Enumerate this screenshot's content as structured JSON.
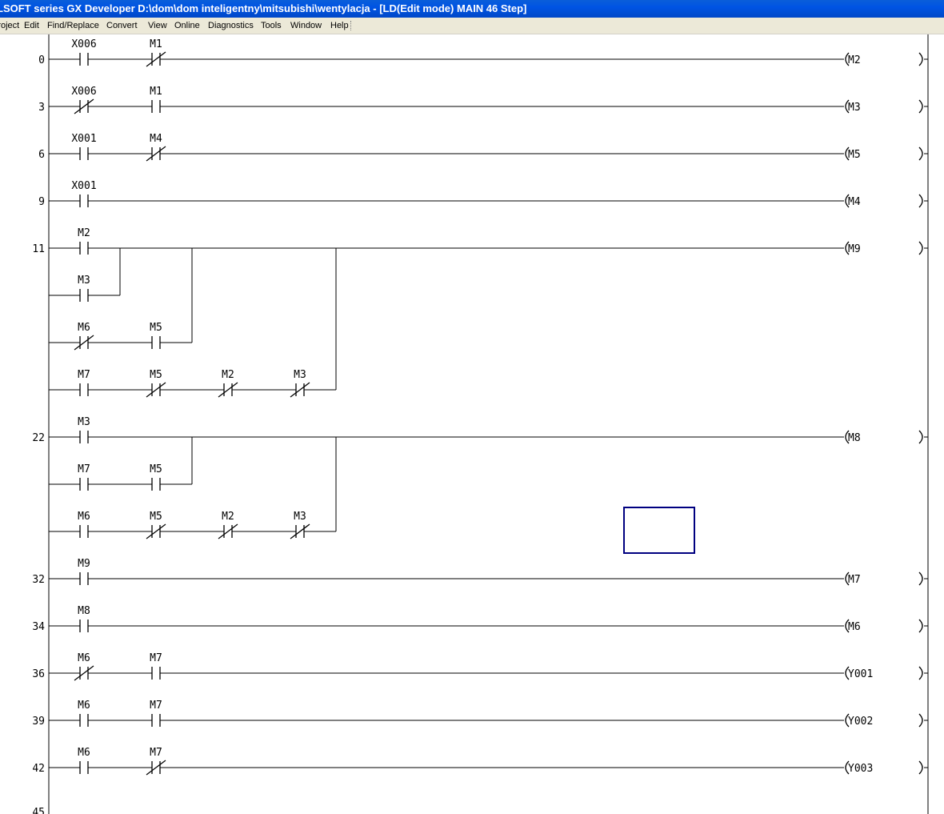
{
  "window": {
    "title": "LSOFT series GX Developer D:\\dom\\dom inteligentny\\mitsubishi\\wentylacja - [LD(Edit mode)     MAIN     46 Step]"
  },
  "menu": [
    {
      "id": "project",
      "label": "Project"
    },
    {
      "id": "edit",
      "label": "Edit"
    },
    {
      "id": "find-replace",
      "label": "Find/Replace"
    },
    {
      "id": "convert",
      "label": "Convert"
    },
    {
      "id": "view",
      "label": "View"
    },
    {
      "id": "online",
      "label": "Online"
    },
    {
      "id": "diagnostics",
      "label": "Diagnostics"
    },
    {
      "id": "tools",
      "label": "Tools"
    },
    {
      "id": "window",
      "label": "Window"
    },
    {
      "id": "help",
      "label": "Help"
    }
  ],
  "ladder": {
    "rungs": [
      {
        "step": "0",
        "rows": [
          [
            {
              "dev": "X006",
              "type": "NO"
            },
            {
              "dev": "M1",
              "type": "NC"
            }
          ]
        ],
        "coil": "M2"
      },
      {
        "step": "3",
        "rows": [
          [
            {
              "dev": "X006",
              "type": "NC"
            },
            {
              "dev": "M1",
              "type": "NO"
            }
          ]
        ],
        "coil": "M3"
      },
      {
        "step": "6",
        "rows": [
          [
            {
              "dev": "X001",
              "type": "NO"
            },
            {
              "dev": "M4",
              "type": "NC"
            }
          ]
        ],
        "coil": "M5"
      },
      {
        "step": "9",
        "rows": [
          [
            {
              "dev": "X001",
              "type": "NO"
            }
          ]
        ],
        "coil": "M4"
      },
      {
        "step": "11",
        "rows": [
          [
            {
              "dev": "M2",
              "type": "NO"
            }
          ],
          [
            {
              "dev": "M3",
              "type": "NO"
            }
          ],
          [
            {
              "dev": "M6",
              "type": "NC"
            },
            {
              "dev": "M5",
              "type": "NO"
            }
          ],
          [
            {
              "dev": "M7",
              "type": "NO"
            },
            {
              "dev": "M5",
              "type": "NC"
            },
            {
              "dev": "M2",
              "type": "NC"
            },
            {
              "dev": "M3",
              "type": "NC"
            }
          ]
        ],
        "coil": "M9"
      },
      {
        "step": "22",
        "rows": [
          [
            {
              "dev": "M3",
              "type": "NO"
            }
          ],
          [
            {
              "dev": "M7",
              "type": "NO"
            },
            {
              "dev": "M5",
              "type": "NO"
            }
          ],
          [
            {
              "dev": "M6",
              "type": "NO"
            },
            {
              "dev": "M5",
              "type": "NC"
            },
            {
              "dev": "M2",
              "type": "NC"
            },
            {
              "dev": "M3",
              "type": "NC"
            }
          ]
        ],
        "coil": "M8"
      },
      {
        "step": "32",
        "rows": [
          [
            {
              "dev": "M9",
              "type": "NO"
            }
          ]
        ],
        "coil": "M7"
      },
      {
        "step": "34",
        "rows": [
          [
            {
              "dev": "M8",
              "type": "NO"
            }
          ]
        ],
        "coil": "M6"
      },
      {
        "step": "36",
        "rows": [
          [
            {
              "dev": "M6",
              "type": "NC"
            },
            {
              "dev": "M7",
              "type": "NO"
            }
          ]
        ],
        "coil": "Y001"
      },
      {
        "step": "39",
        "rows": [
          [
            {
              "dev": "M6",
              "type": "NO"
            },
            {
              "dev": "M7",
              "type": "NO"
            }
          ]
        ],
        "coil": "Y002"
      },
      {
        "step": "42",
        "rows": [
          [
            {
              "dev": "M6",
              "type": "NO"
            },
            {
              "dev": "M7",
              "type": "NC"
            }
          ]
        ],
        "coil": "Y003"
      }
    ],
    "cursor": {
      "rung_index": 5,
      "row": 2,
      "column": 8
    }
  },
  "colors": {
    "title_bg": "#0054e3",
    "menu_bg": "#ece9d8",
    "cursor": "#000080",
    "line": "#000000"
  }
}
